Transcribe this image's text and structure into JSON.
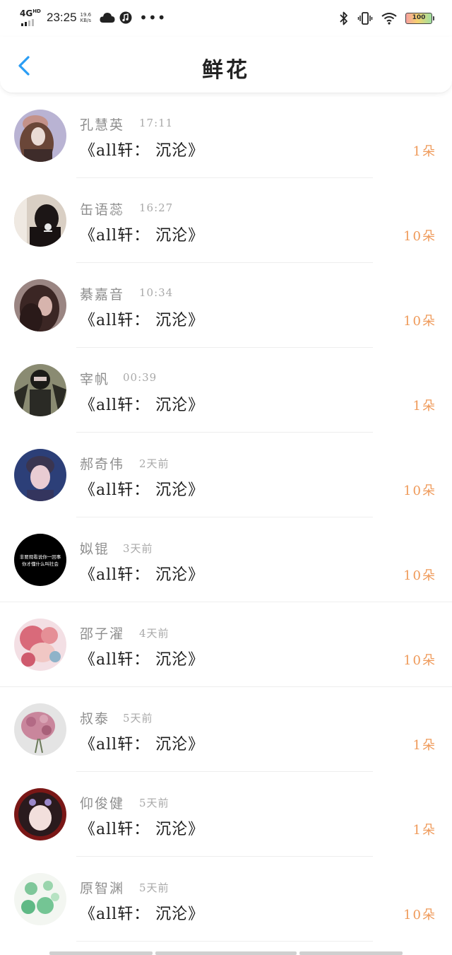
{
  "status_bar": {
    "network": "4G",
    "network_sup": "HD",
    "time": "23:25",
    "speed_value": "19.6",
    "speed_unit": "KB/s",
    "battery": "100"
  },
  "header": {
    "title": "鲜花",
    "back_icon": "chevron-left-icon",
    "accent_color": "#2a9df4"
  },
  "colors": {
    "count": "#ef9a5a",
    "name": "#8e8e8e",
    "time": "#a9a9a9"
  },
  "rows": [
    {
      "name": "孔慧英",
      "time": "17:11",
      "book": "《all轩：  沉沦》",
      "count": "1朵"
    },
    {
      "name": "缶语蕊",
      "time": "16:27",
      "book": "《all轩：  沉沦》",
      "count": "10朵"
    },
    {
      "name": "綦嘉音",
      "time": "10:34",
      "book": "《all轩：  沉沦》",
      "count": "10朵"
    },
    {
      "name": "宰帆",
      "time": "00:39",
      "book": "《all轩：  沉沦》",
      "count": "1朵"
    },
    {
      "name": "郝奇伟",
      "time": "2天前",
      "book": "《all轩：  沉沦》",
      "count": "10朵"
    },
    {
      "name": "姒锟",
      "time": "3天前",
      "book": "《all轩：  沉沦》",
      "count": "10朵",
      "avatar_text": "非要观看说你一回事\n你才懂什么叫社会"
    },
    {
      "name": "邵子濯",
      "time": "4天前",
      "book": "《all轩：  沉沦》",
      "count": "10朵"
    },
    {
      "name": "叔泰",
      "time": "5天前",
      "book": "《all轩：  沉沦》",
      "count": "1朵"
    },
    {
      "name": "仰俊健",
      "time": "5天前",
      "book": "《all轩：  沉沦》",
      "count": "1朵"
    },
    {
      "name": "原智渊",
      "time": "5天前",
      "book": "《all轩：  沉沦》",
      "count": "10朵"
    }
  ]
}
